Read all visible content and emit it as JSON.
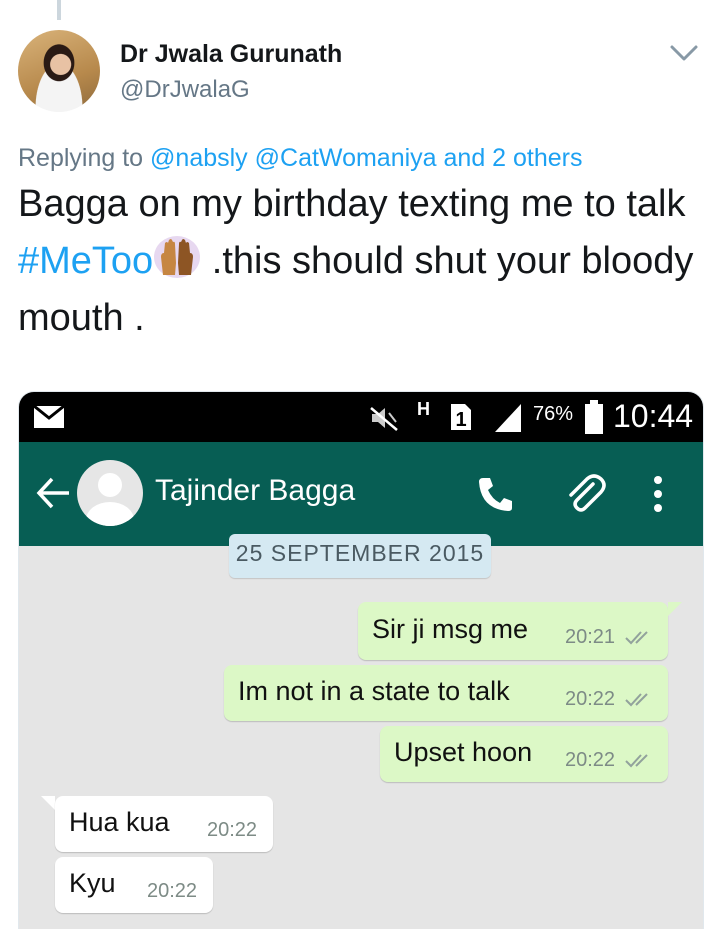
{
  "tweet": {
    "display_name": "Dr Jwala Gurunath",
    "handle": "@DrJwalaG",
    "replying_prefix": "Replying to ",
    "reply_mention_1": "@nabsly",
    "reply_mention_2": "@CatWomaniya",
    "reply_others": "and 2 others",
    "text_part_1": "Bagga on my birthday texting me to talk ",
    "hashtag": "#MeToo",
    "text_part_2": " .this should shut your bloody mouth ."
  },
  "screenshot": {
    "status_bar": {
      "network_type": "H",
      "sim_slot": "1",
      "battery": "76%",
      "time": "10:44"
    },
    "chat_header": {
      "contact_name": "Tajinder Bagga"
    },
    "date_divider": "25 SEPTEMBER 2015",
    "messages": [
      {
        "direction": "outgoing",
        "text": "Sir ji msg me",
        "time": "20:21"
      },
      {
        "direction": "outgoing",
        "text": "Im not in a state to talk",
        "time": "20:22"
      },
      {
        "direction": "outgoing",
        "text": "Upset hoon",
        "time": "20:22"
      },
      {
        "direction": "incoming",
        "text": "Hua kua",
        "time": "20:22"
      },
      {
        "direction": "incoming",
        "text": "Kyu",
        "time": "20:22"
      }
    ]
  },
  "icons": [
    "chevron-down-icon",
    "mail-icon",
    "mute-icon",
    "signal-icon",
    "battery-icon",
    "back-arrow-icon",
    "call-icon",
    "attachment-icon",
    "more-options-icon",
    "double-check-icon",
    "raised-hands-icon"
  ],
  "colors": {
    "link": "#1da1f2",
    "whatsapp_header": "#075e54",
    "outgoing_bubble": "#dcf8c6",
    "incoming_bubble": "#ffffff",
    "chat_background": "#e5e5e5"
  }
}
